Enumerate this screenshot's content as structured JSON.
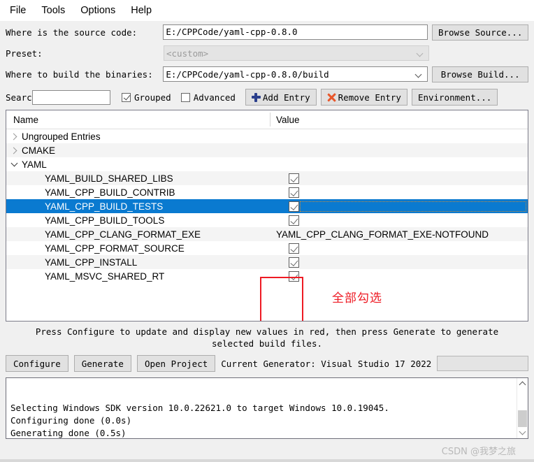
{
  "menubar": {
    "items": [
      {
        "label": "File"
      },
      {
        "label": "Tools"
      },
      {
        "label": "Options"
      },
      {
        "label": "Help"
      }
    ]
  },
  "form": {
    "source_label": "Where is the source code:",
    "source_value": "E:/CPPCode/yaml-cpp-0.8.0",
    "browse_source_label": "Browse Source...",
    "preset_label": "Preset:",
    "preset_value": "<custom>",
    "build_label": "Where to build the binaries:",
    "build_value": "E:/CPPCode/yaml-cpp-0.8.0/build",
    "browse_build_label": "Browse Build..."
  },
  "toolbar": {
    "search_label": "Search:",
    "search_value": "",
    "search_placeholder": "",
    "grouped_label": "Grouped",
    "grouped_checked": true,
    "advanced_label": "Advanced",
    "advanced_checked": false,
    "add_entry_label": "Add Entry",
    "remove_entry_label": "Remove Entry",
    "environment_label": "Environment..."
  },
  "table": {
    "col_name": "Name",
    "col_value": "Value",
    "rows": [
      {
        "name": "Ungrouped Entries",
        "kind": "group",
        "expanded": false,
        "value": "",
        "value_type": "none",
        "selected": false
      },
      {
        "name": "CMAKE",
        "kind": "group",
        "expanded": false,
        "value": "",
        "value_type": "none",
        "selected": false
      },
      {
        "name": "YAML",
        "kind": "group",
        "expanded": true,
        "value": "",
        "value_type": "none",
        "selected": false
      },
      {
        "name": "YAML_BUILD_SHARED_LIBS",
        "kind": "entry",
        "value": "",
        "value_type": "checkbox",
        "checked": true,
        "selected": false
      },
      {
        "name": "YAML_CPP_BUILD_CONTRIB",
        "kind": "entry",
        "value": "",
        "value_type": "checkbox",
        "checked": true,
        "selected": false
      },
      {
        "name": "YAML_CPP_BUILD_TESTS",
        "kind": "entry",
        "value": "",
        "value_type": "checkbox",
        "checked": true,
        "selected": true
      },
      {
        "name": "YAML_CPP_BUILD_TOOLS",
        "kind": "entry",
        "value": "",
        "value_type": "checkbox",
        "checked": true,
        "selected": false
      },
      {
        "name": "YAML_CPP_CLANG_FORMAT_EXE",
        "kind": "entry",
        "value": "YAML_CPP_CLANG_FORMAT_EXE-NOTFOUND",
        "value_type": "text",
        "selected": false
      },
      {
        "name": "YAML_CPP_FORMAT_SOURCE",
        "kind": "entry",
        "value": "",
        "value_type": "checkbox",
        "checked": true,
        "selected": false
      },
      {
        "name": "YAML_CPP_INSTALL",
        "kind": "entry",
        "value": "",
        "value_type": "checkbox",
        "checked": true,
        "selected": false
      },
      {
        "name": "YAML_MSVC_SHARED_RT",
        "kind": "entry",
        "value": "",
        "value_type": "checkbox",
        "checked": true,
        "selected": false
      }
    ]
  },
  "annotation": {
    "note_text": "全部勾选",
    "note_color": "#ee1b24"
  },
  "hint": {
    "line1": "Press Configure to update and display new values in red, then press Generate to generate",
    "line2": "selected build files."
  },
  "actions": {
    "configure_label": "Configure",
    "generate_label": "Generate",
    "open_project_label": "Open Project",
    "generator_text": "Current Generator: Visual Studio 17 2022"
  },
  "output": {
    "lines": [
      "Selecting Windows SDK version 10.0.22621.0 to target Windows 10.0.19045.",
      "Configuring done (0.0s)",
      "Generating done (0.5s)"
    ]
  },
  "watermark": {
    "text": "CSDN @我梦之旅"
  }
}
